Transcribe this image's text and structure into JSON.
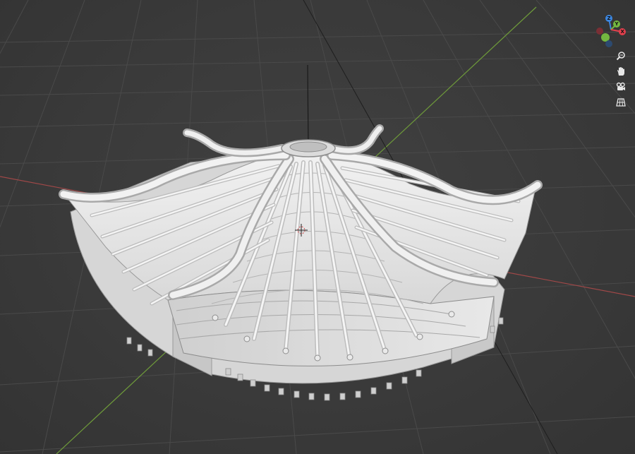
{
  "viewport": {
    "name": "3D Viewport",
    "object": "pavilion-roof-model",
    "colors": {
      "background": "#3a3a3a",
      "grid": "#4a4a4a",
      "x_axis": "#a04848",
      "y_axis": "#6e9a3a",
      "z_axis": "#1a1a1a",
      "mesh": "#e6e6e6",
      "mesh_shadow": "#b9b9b9"
    }
  },
  "gizmo": {
    "z_label": "Z",
    "y_label": "Y",
    "x_label": "X",
    "colors": {
      "x": "#e3404d",
      "y": "#74b840",
      "z": "#3b86e0",
      "neg_x": "#7a2f35",
      "neg_y": "#3d5e2b",
      "neg_z": "#2c4a70"
    }
  },
  "tools": [
    {
      "id": "zoom",
      "icon": "magnifier-icon"
    },
    {
      "id": "pan",
      "icon": "hand-icon"
    },
    {
      "id": "camera",
      "icon": "camera-icon"
    },
    {
      "id": "perspective",
      "icon": "grid-perspective-icon"
    }
  ]
}
